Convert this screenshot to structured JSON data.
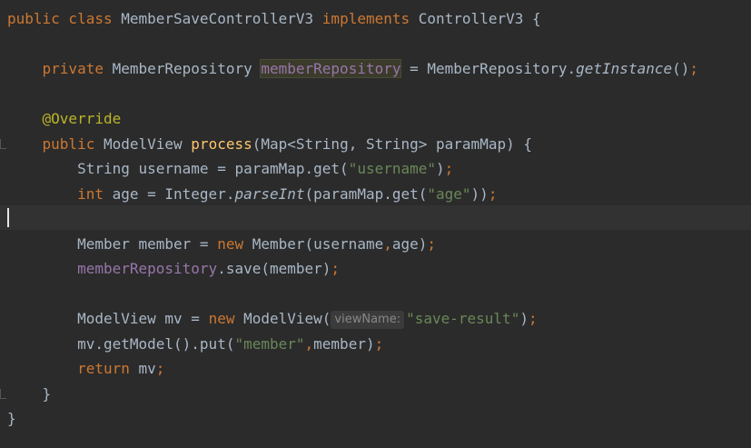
{
  "editor": {
    "theme_colors": {
      "background": "#2b2b2b",
      "caret_line": "#323232",
      "keyword": "#cc7832",
      "annotation": "#bbb529",
      "method_declaration": "#ffc66d",
      "string": "#6a8759",
      "field": "#9876aa",
      "default_text": "#a9b7c6"
    },
    "lines": {
      "l1": {
        "kw1": "public class ",
        "t1": "MemberSaveControllerV3 ",
        "kw2": "implements ",
        "t2": "ControllerV3 {"
      },
      "l3": {
        "indent": "    ",
        "kw1": "private ",
        "t1": "MemberRepository ",
        "field": "memberRepository",
        "t2": " = MemberRepository.",
        "call": "getInstance",
        "t3": "()",
        "semi": ";"
      },
      "l5": {
        "indent": "    ",
        "ann": "@Override"
      },
      "l6": {
        "indent": "    ",
        "kw1": "public ",
        "t1": "ModelView ",
        "fn": "process",
        "t2": "(Map<String, String> paramMap) {"
      },
      "l7": {
        "indent": "        ",
        "t1": "String username = paramMap.get(",
        "str": "\"username\"",
        "t2": ")",
        "semi": ";"
      },
      "l8": {
        "indent": "        ",
        "kw1": "int ",
        "t1": "age = Integer.",
        "call": "parseInt",
        "t2": "(paramMap.get(",
        "str": "\"age\"",
        "t3": "))",
        "semi": ";"
      },
      "l10": {
        "indent": "        ",
        "t1": "Member member = ",
        "kw1": "new ",
        "t2": "Member(username",
        "comma": ",",
        "t3": "age)",
        "semi": ";"
      },
      "l11": {
        "indent": "        ",
        "field": "memberRepository",
        "t1": ".save(member)",
        "semi": ";"
      },
      "l13": {
        "indent": "        ",
        "t1": "ModelView mv = ",
        "kw1": "new ",
        "t2": "ModelView(",
        "hint": "viewName:",
        "str": "\"save-result\"",
        "t3": ")",
        "semi": ";"
      },
      "l14": {
        "indent": "        ",
        "t1": "mv.getModel().put(",
        "str": "\"member\"",
        "comma": ",",
        "t2": "member)",
        "semi": ";"
      },
      "l15": {
        "indent": "        ",
        "kw1": "return ",
        "t1": "mv",
        "semi": ";"
      },
      "l16": {
        "indent": "    ",
        "t1": "}"
      },
      "l17": {
        "t1": "}"
      }
    }
  }
}
